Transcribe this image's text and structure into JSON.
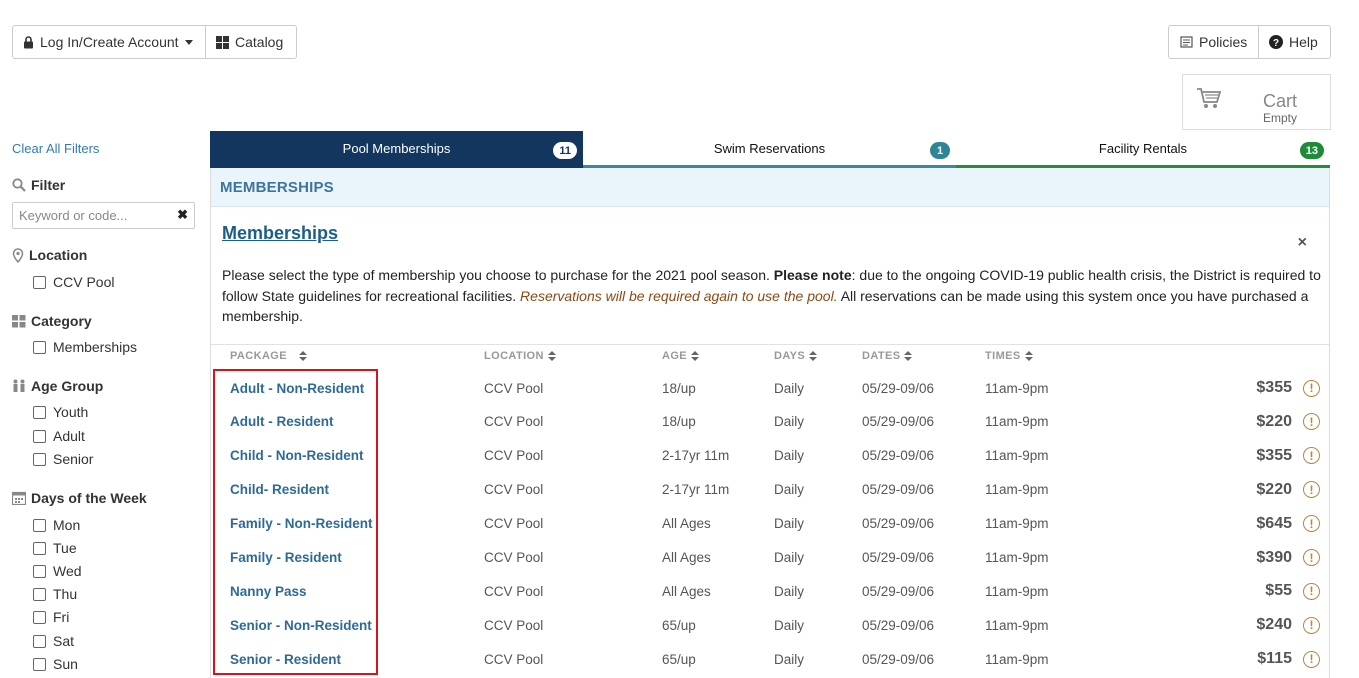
{
  "header": {
    "login_label": "Log In/Create Account",
    "catalog_label": "Catalog",
    "policies_label": "Policies",
    "help_label": "Help"
  },
  "cart": {
    "title": "Cart",
    "status": "Empty"
  },
  "sidebar": {
    "clear_label": "Clear All Filters",
    "filter_heading": "Filter",
    "search_placeholder": "Keyword or code...",
    "location": {
      "heading": "Location",
      "options": [
        "CCV Pool"
      ]
    },
    "category": {
      "heading": "Category",
      "options": [
        "Memberships"
      ]
    },
    "age_group": {
      "heading": "Age Group",
      "options": [
        "Youth",
        "Adult",
        "Senior"
      ]
    },
    "days": {
      "heading": "Days of the Week",
      "options": [
        "Mon",
        "Tue",
        "Wed",
        "Thu",
        "Fri",
        "Sat",
        "Sun"
      ]
    }
  },
  "tabs": [
    {
      "label": "Pool Memberships",
      "count": "11"
    },
    {
      "label": "Swim Reservations",
      "count": "1"
    },
    {
      "label": "Facility Rentals",
      "count": "13"
    }
  ],
  "panel": {
    "header": "MEMBERSHIPS",
    "section_title": "Memberships",
    "close_glyph": "×",
    "desc_part1": "Please select the type of membership you choose to purchase for the 2021 pool season. ",
    "desc_bold": "Please note",
    "desc_part2": ": due to the ongoing COVID-19 public health crisis, the District is required to follow State guidelines for recreational facilities. ",
    "desc_italic": "Reservations will be required again to use the pool.",
    "desc_part3": " All reservations can be made using this system once you have purchased a membership."
  },
  "table": {
    "columns": {
      "package": "PACKAGE",
      "location": "LOCATION",
      "age": "AGE",
      "days": "DAYS",
      "dates": "DATES",
      "times": "TIMES"
    },
    "rows": [
      {
        "package": "Adult - Non-Resident",
        "location": "CCV Pool",
        "age": "18/up",
        "days": "Daily",
        "dates": "05/29-09/06",
        "times": "11am-9pm",
        "price": "$355"
      },
      {
        "package": "Adult - Resident",
        "location": "CCV Pool",
        "age": "18/up",
        "days": "Daily",
        "dates": "05/29-09/06",
        "times": "11am-9pm",
        "price": "$220"
      },
      {
        "package": "Child - Non-Resident",
        "location": "CCV Pool",
        "age": "2-17yr 11m",
        "days": "Daily",
        "dates": "05/29-09/06",
        "times": "11am-9pm",
        "price": "$355"
      },
      {
        "package": "Child- Resident",
        "location": "CCV Pool",
        "age": "2-17yr 11m",
        "days": "Daily",
        "dates": "05/29-09/06",
        "times": "11am-9pm",
        "price": "$220"
      },
      {
        "package": "Family - Non-Resident",
        "location": "CCV Pool",
        "age": "All Ages",
        "days": "Daily",
        "dates": "05/29-09/06",
        "times": "11am-9pm",
        "price": "$645"
      },
      {
        "package": "Family - Resident",
        "location": "CCV Pool",
        "age": "All Ages",
        "days": "Daily",
        "dates": "05/29-09/06",
        "times": "11am-9pm",
        "price": "$390"
      },
      {
        "package": "Nanny Pass",
        "location": "CCV Pool",
        "age": "All Ages",
        "days": "Daily",
        "dates": "05/29-09/06",
        "times": "11am-9pm",
        "price": "$55"
      },
      {
        "package": "Senior - Non-Resident",
        "location": "CCV Pool",
        "age": "65/up",
        "days": "Daily",
        "dates": "05/29-09/06",
        "times": "11am-9pm",
        "price": "$240"
      },
      {
        "package": "Senior - Resident",
        "location": "CCV Pool",
        "age": "65/up",
        "days": "Daily",
        "dates": "05/29-09/06",
        "times": "11am-9pm",
        "price": "$115"
      }
    ]
  },
  "colors": {
    "active_tab": "#12365d",
    "link": "#2f6a94",
    "highlight": "#d0161e",
    "swim_badge": "#2f8596",
    "facility_badge": "#1e8a3a"
  }
}
